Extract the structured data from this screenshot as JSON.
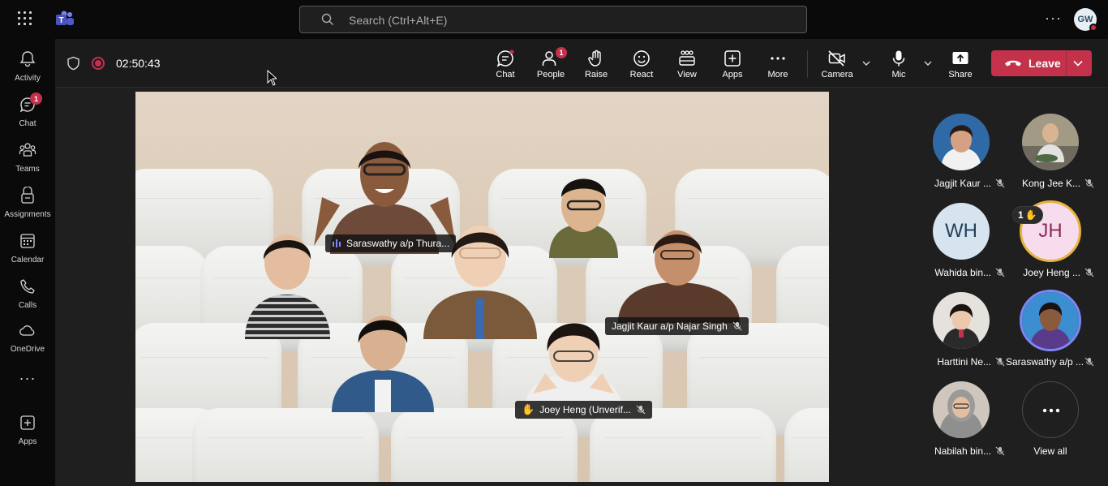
{
  "app": {
    "search_placeholder": "Search (Ctrl+Alt+E)",
    "user_initials": "GW"
  },
  "rail": [
    {
      "label": "Activity",
      "icon": "bell-icon"
    },
    {
      "label": "Chat",
      "icon": "chat-icon",
      "badge": "1"
    },
    {
      "label": "Teams",
      "icon": "teams-icon"
    },
    {
      "label": "Assignments",
      "icon": "assignments-icon"
    },
    {
      "label": "Calendar",
      "icon": "calendar-icon"
    },
    {
      "label": "Calls",
      "icon": "phone-icon"
    },
    {
      "label": "OneDrive",
      "icon": "cloud-icon"
    },
    {
      "label": "Apps",
      "icon": "plus-square-icon"
    }
  ],
  "meeting": {
    "elapsed": "02:50:43",
    "controls": {
      "chat": "Chat",
      "people": "People",
      "people_badge": "1",
      "raise": "Raise",
      "react": "React",
      "view": "View",
      "apps": "Apps",
      "more": "More",
      "camera": "Camera",
      "mic": "Mic",
      "share": "Share",
      "leave": "Leave"
    }
  },
  "video_labels": {
    "saraswathy": "Saraswathy a/p Thura...",
    "jagjit": "Jagjit Kaur a/p Najar Singh",
    "joey": "Joey Heng (Unverif..."
  },
  "roster": [
    {
      "name": "Jagjit Kaur ...",
      "muted": true
    },
    {
      "name": "Kong Jee K...",
      "muted": true
    },
    {
      "name": "Wahida bin...",
      "initials": "WH",
      "muted": true
    },
    {
      "name": "Joey Heng ...",
      "initials": "JH",
      "muted": true,
      "hand_count": "1"
    },
    {
      "name": "Harttini Ne...",
      "muted": true
    },
    {
      "name": "Saraswathy a/p ...",
      "muted": true
    },
    {
      "name": "Nabilah bin...",
      "muted": true
    },
    {
      "name": "View all"
    }
  ],
  "colors": {
    "accent": "#c4314b",
    "brand": "#6264a7",
    "ring_gold": "#e8b33e",
    "ring_purple": "#7f85f5"
  }
}
